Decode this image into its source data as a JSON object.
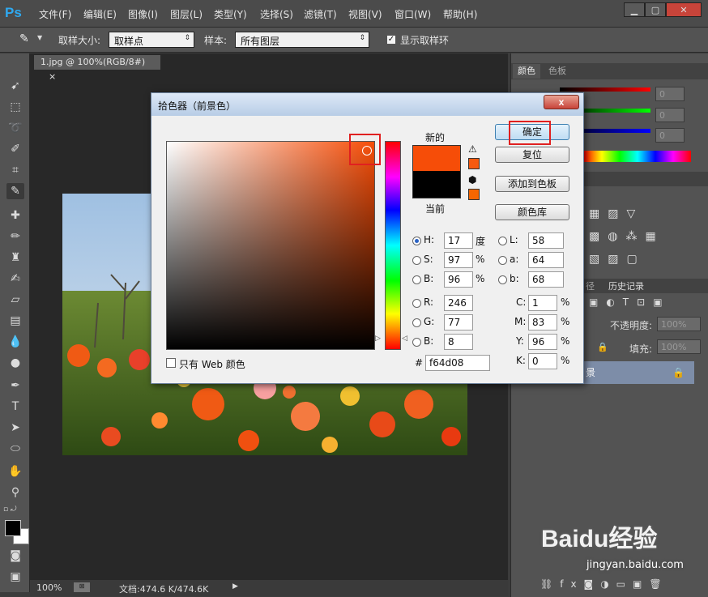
{
  "app": {
    "logo": "Ps"
  },
  "menubar": {
    "items": [
      "文件(F)",
      "编辑(E)",
      "图像(I)",
      "图层(L)",
      "类型(Y)",
      "选择(S)",
      "滤镜(T)",
      "视图(V)",
      "窗口(W)",
      "帮助(H)"
    ]
  },
  "optionsbar": {
    "sample_size_label": "取样大小:",
    "sample_size_value": "取样点",
    "sample_label": "样本:",
    "sample_value": "所有图层",
    "show_ring_label": "显示取样环",
    "show_ring_checked": true
  },
  "document": {
    "tab_title": "1.jpg @ 100%(RGB/8#)",
    "tab_close": "×"
  },
  "statusbar": {
    "zoom": "100%",
    "doc_info": "文档:474.6 K/474.6K"
  },
  "panels": {
    "color_tabs": [
      "颜色",
      "色板"
    ],
    "rgb_values": [
      "0",
      "0",
      "0"
    ],
    "history_tabs": [
      "径",
      "历史记录"
    ],
    "opacity_label": "不透明度:",
    "opacity_value": "100%",
    "fill_label": "填充:",
    "fill_value": "100%",
    "layer_name": "景"
  },
  "dialog": {
    "title": "拾色器（前景色）",
    "close": "x",
    "new_label": "新的",
    "current_label": "当前",
    "new_color": "#f64d08",
    "current_color": "#000000",
    "buttons": {
      "ok": "确定",
      "reset": "复位",
      "add_swatch": "添加到色板",
      "libraries": "颜色库"
    },
    "hsb": {
      "H": {
        "label": "H:",
        "value": "17",
        "unit": "度"
      },
      "S": {
        "label": "S:",
        "value": "97",
        "unit": "%"
      },
      "B": {
        "label": "B:",
        "value": "96",
        "unit": "%"
      }
    },
    "lab": {
      "L": {
        "label": "L:",
        "value": "58"
      },
      "a": {
        "label": "a:",
        "value": "64"
      },
      "b": {
        "label": "b:",
        "value": "68"
      }
    },
    "rgb": {
      "R": {
        "label": "R:",
        "value": "246"
      },
      "G": {
        "label": "G:",
        "value": "77"
      },
      "B": {
        "label": "B:",
        "value": "8"
      }
    },
    "cmyk": {
      "C": {
        "label": "C:",
        "value": "1",
        "unit": "%"
      },
      "M": {
        "label": "M:",
        "value": "83",
        "unit": "%"
      },
      "Y": {
        "label": "Y:",
        "value": "96",
        "unit": "%"
      },
      "K": {
        "label": "K:",
        "value": "0",
        "unit": "%"
      }
    },
    "hex_label": "#",
    "hex_value": "f64d08",
    "web_only_label": "只有 Web 颜色"
  },
  "watermark": {
    "brand": "Baidu经验",
    "url": "jingyan.baidu.com"
  }
}
